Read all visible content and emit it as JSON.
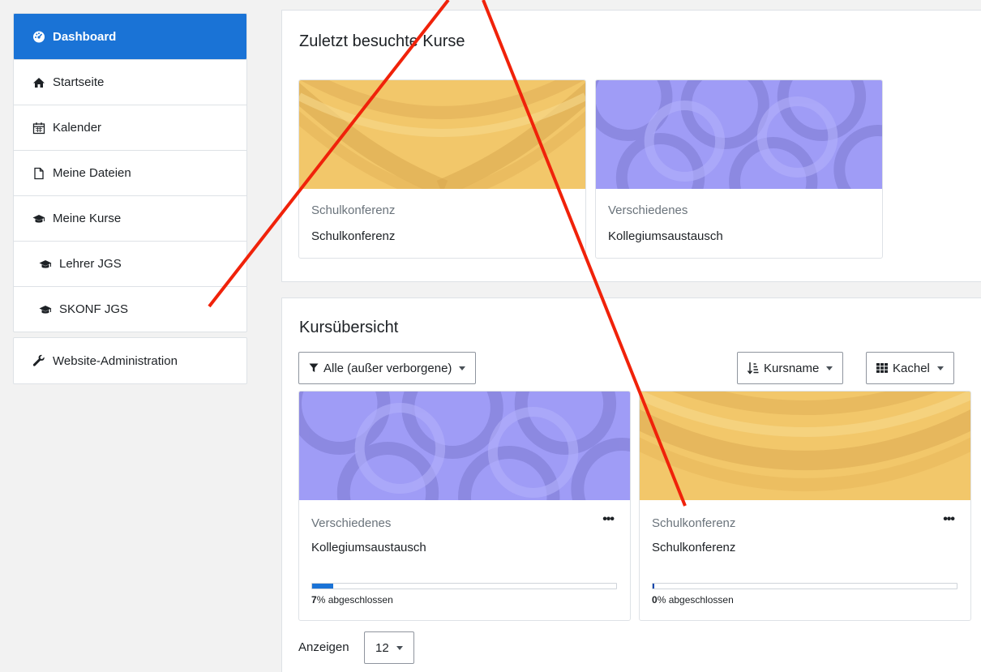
{
  "sidebar": {
    "items": [
      {
        "label": "Dashboard",
        "icon": "tachometer-icon",
        "active": true
      },
      {
        "label": "Startseite",
        "icon": "home-icon"
      },
      {
        "label": "Kalender",
        "icon": "calendar-icon"
      },
      {
        "label": "Meine Dateien",
        "icon": "file-icon"
      },
      {
        "label": "Meine Kurse",
        "icon": "graduation-cap-icon"
      },
      {
        "label": "Lehrer JGS",
        "icon": "graduation-cap-icon"
      },
      {
        "label": "SKONF JGS",
        "icon": "graduation-cap-icon"
      }
    ],
    "admin": {
      "label": "Website-Administration",
      "icon": "wrench-icon"
    }
  },
  "recent": {
    "title": "Zuletzt besuchte Kurse",
    "courses": [
      {
        "category": "Schulkonferenz",
        "name": "Schulkonferenz",
        "color": "#f2c76a"
      },
      {
        "category": "Verschiedenes",
        "name": "Kollegiumsaustausch",
        "color": "#9f9cf6"
      }
    ]
  },
  "overview": {
    "title": "Kursübersicht",
    "filter_label": "Alle (außer verborgene)",
    "sort_label": "Kursname",
    "view_label": "Kachel",
    "courses": [
      {
        "category": "Verschiedenes",
        "name": "Kollegiumsaustausch",
        "progress_value": "7",
        "progress_suffix": "% abgeschlossen",
        "progress": 0.07,
        "color": "#9f9cf6"
      },
      {
        "category": "Schulkonferenz",
        "name": "Schulkonferenz",
        "progress_value": "0",
        "progress_suffix": "% abgeschlossen",
        "progress": 0.0,
        "color": "#f2c76a"
      }
    ],
    "show_label": "Anzeigen",
    "show_value": "12"
  },
  "colors": {
    "accent": "#1a73d6",
    "annotation": "#f0220a"
  }
}
